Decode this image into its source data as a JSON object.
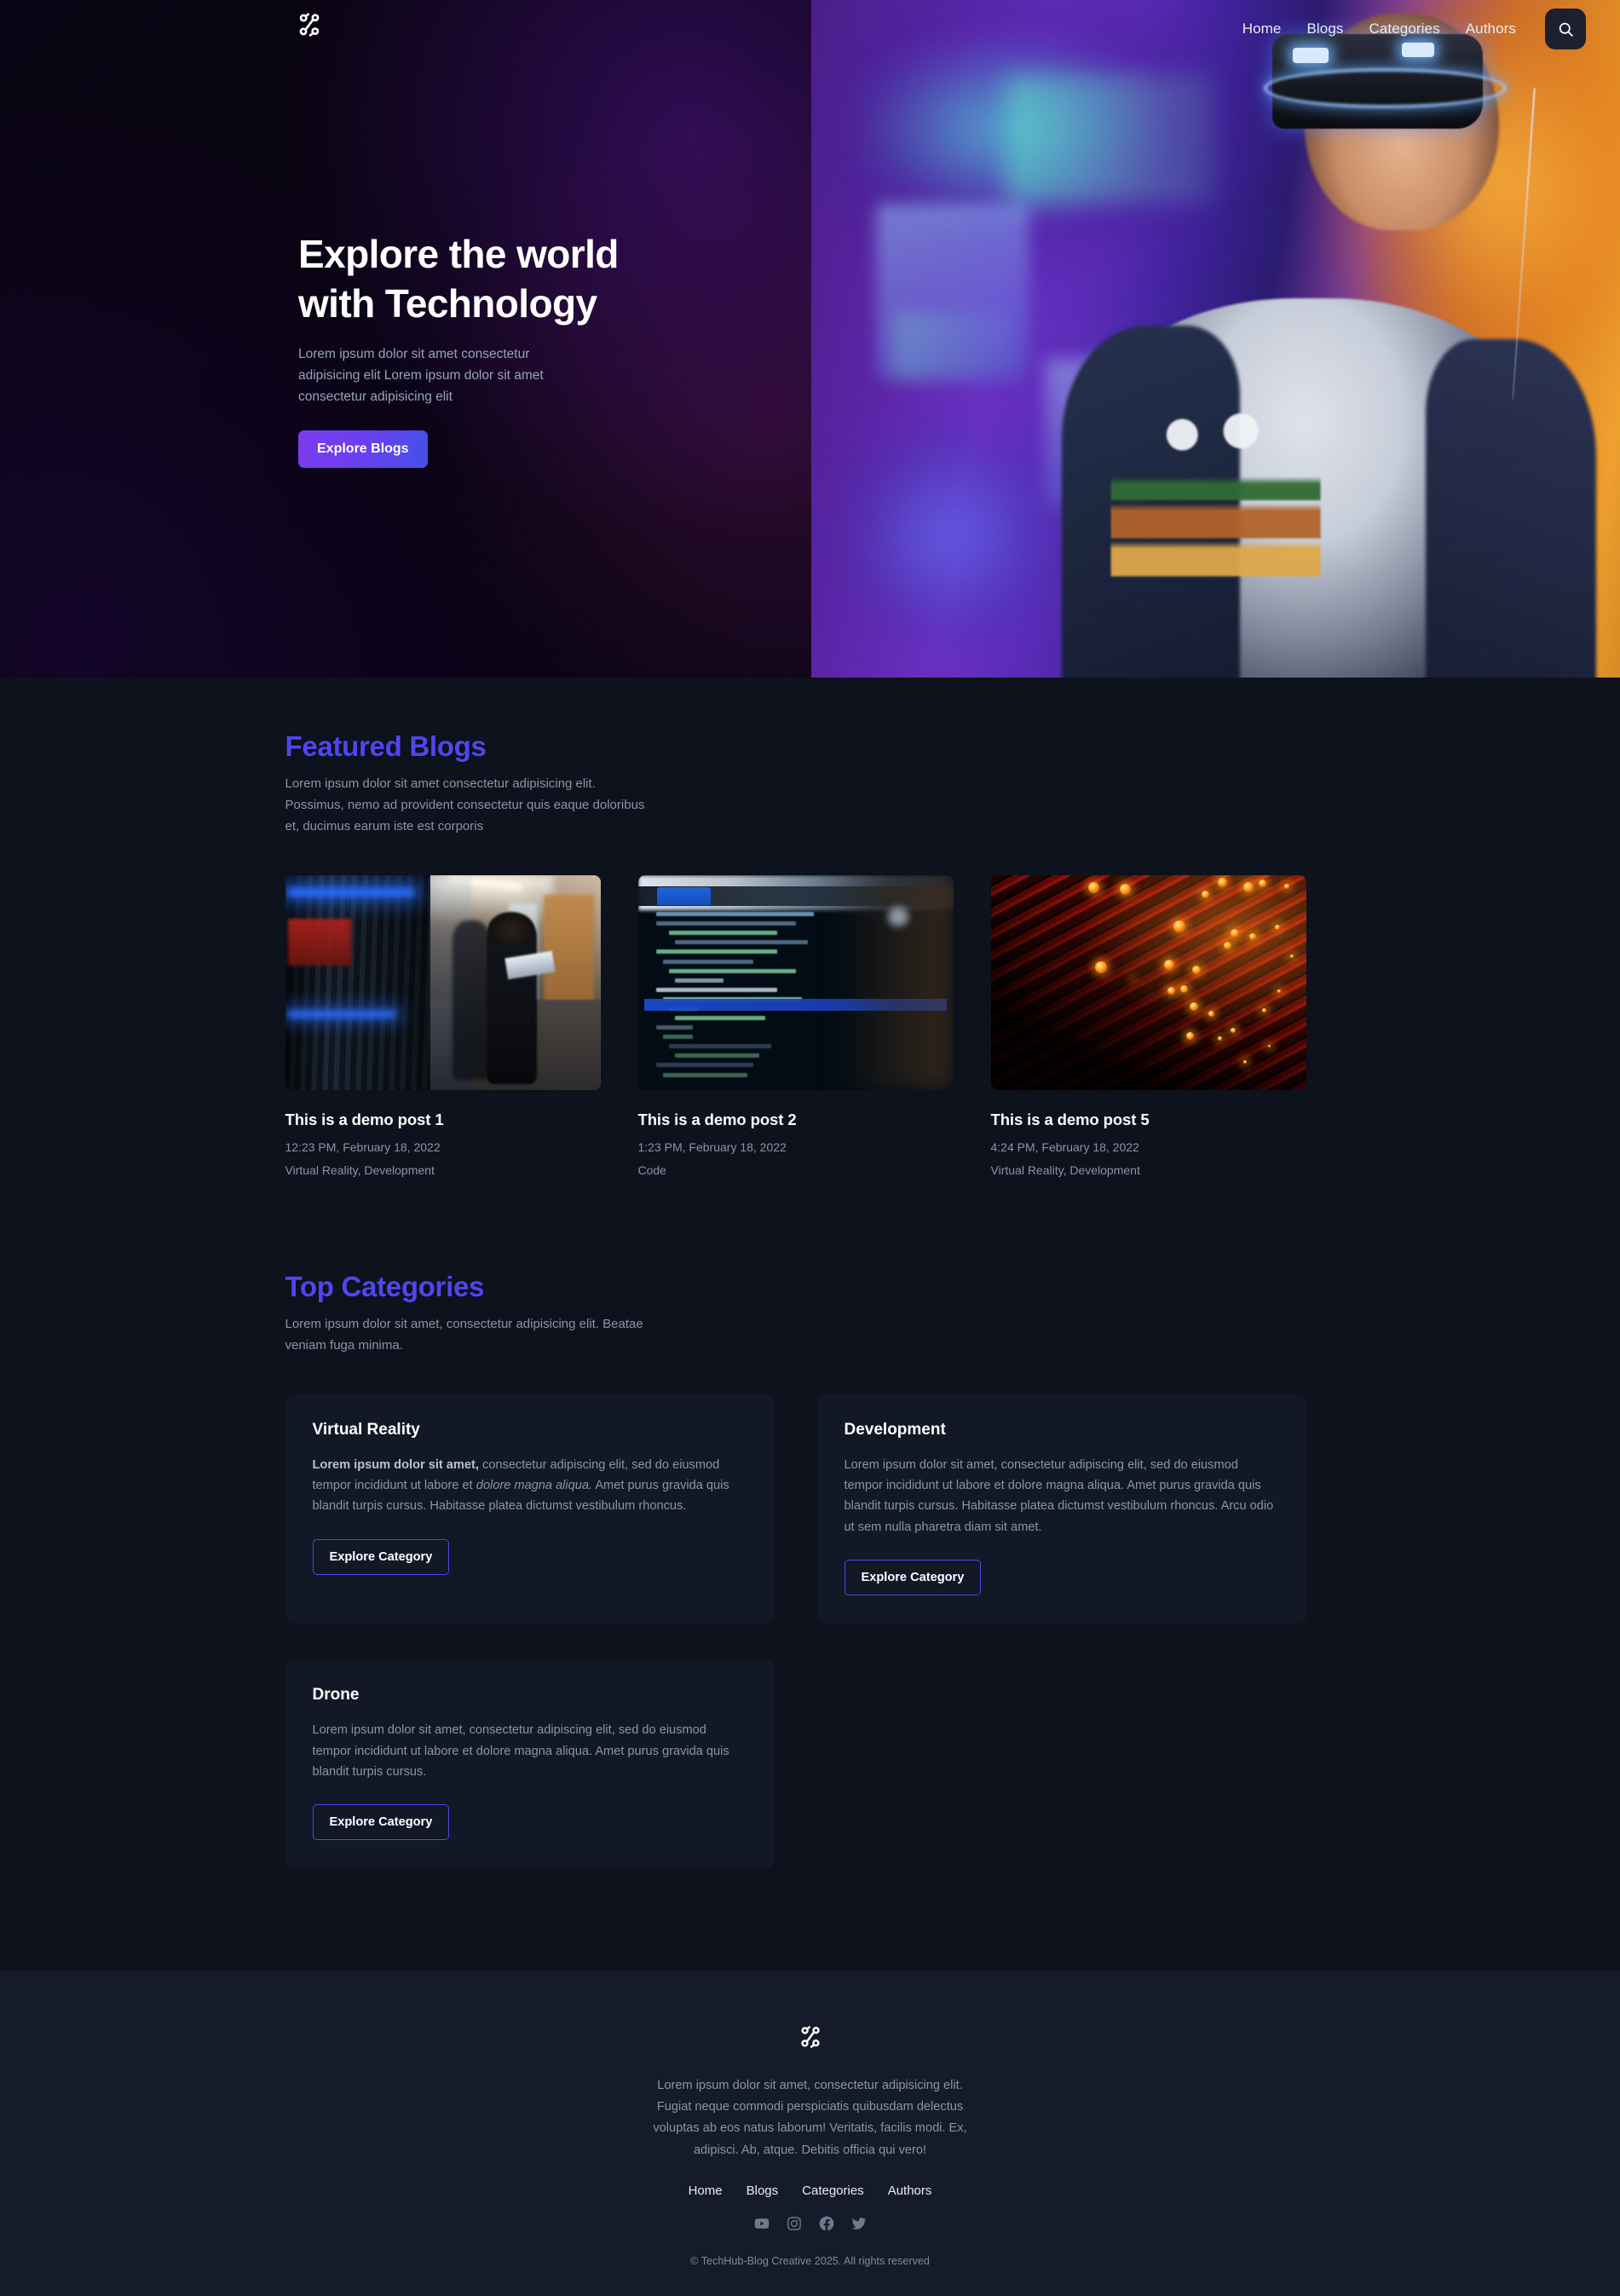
{
  "header": {
    "logo_icon": "network-nodes-logo",
    "nav": [
      {
        "label": "Home"
      },
      {
        "label": "Blogs"
      },
      {
        "label": "Categories"
      },
      {
        "label": "Authors"
      }
    ],
    "search_icon": "search-icon"
  },
  "hero": {
    "title_line1": "Explore the world",
    "title_line2": "with Technology",
    "subtitle": "Lorem ipsum dolor sit amet consectetur adipisicing elit Lorem ipsum dolor sit amet consectetur adipisicing elit",
    "cta_label": "Explore Blogs",
    "image_alt": "boy-wearing-vr-headset-in-arcade"
  },
  "featured": {
    "title": "Featured Blogs",
    "subtitle": "Lorem ipsum dolor sit amet consectetur adipisicing elit. Possimus, nemo ad provident consectetur quis eaque doloribus et, ducimus earum iste est corporis",
    "posts": [
      {
        "title": "This is a demo post 1",
        "date": "12:23 PM, February 18, 2022",
        "categories": "Virtual Reality, Development",
        "image_alt": "woman-with-laptop-in-server-room"
      },
      {
        "title": "This is a demo post 2",
        "date": "1:23 PM, February 18, 2022",
        "categories": "Code",
        "image_alt": "browser-devtools-inspector-html-code"
      },
      {
        "title": "This is a demo post 5",
        "date": "4:24 PM, February 18, 2022",
        "categories": "Virtual Reality, Development",
        "image_alt": "red-orange-fiber-optic-strands"
      }
    ]
  },
  "categories": {
    "title": "Top Categories",
    "subtitle": "Lorem ipsum dolor sit amet, consectetur adipisicing elit. Beatae veniam fuga minima.",
    "items": [
      {
        "name": "Virtual Reality",
        "body_bold": "Lorem ipsum dolor sit amet,",
        "body_part1": " consectetur adipiscing elit, sed do eiusmod tempor incididunt ut labore et ",
        "body_italic": "dolore magna aliqua.",
        "body_part2": " Amet purus gravida quis blandit turpis cursus. Habitasse platea dictumst vestibulum rhoncus.",
        "cta_label": "Explore Category"
      },
      {
        "name": "Development",
        "body": "Lorem ipsum dolor sit amet, consectetur adipiscing elit, sed do eiusmod tempor incididunt ut labore et dolore magna aliqua. Amet purus gravida quis blandit turpis cursus. Habitasse platea dictumst vestibulum rhoncus. Arcu odio ut sem nulla pharetra diam sit amet.",
        "cta_label": "Explore Category"
      },
      {
        "name": "Drone",
        "body": "Lorem ipsum dolor sit amet, consectetur adipiscing elit, sed do eiusmod tempor incididunt ut labore et dolore magna aliqua. Amet purus gravida quis blandit turpis cursus.",
        "cta_label": "Explore Category"
      }
    ]
  },
  "footer": {
    "logo_icon": "network-nodes-logo",
    "text": "Lorem ipsum dolor sit amet, consectetur adipisicing elit. Fugiat neque commodi perspiciatis quibusdam delectus voluptas ab eos natus laborum! Veritatis, facilis modi. Ex, adipisci. Ab, atque. Debitis officia qui vero!",
    "nav": [
      {
        "label": "Home"
      },
      {
        "label": "Blogs"
      },
      {
        "label": "Categories"
      },
      {
        "label": "Authors"
      }
    ],
    "socials": [
      {
        "name": "youtube-icon"
      },
      {
        "name": "instagram-icon"
      },
      {
        "name": "facebook-icon"
      },
      {
        "name": "twitter-icon"
      }
    ],
    "copyright": "© TechHub-Blog Creative 2025. All rights reserved"
  },
  "theme": {
    "accent": "#4f46f0",
    "cta_gradient_from": "#7b3ced",
    "cta_gradient_to": "#4550e8",
    "page_bg": "#0d121c",
    "hero_bg": "#07030f",
    "card_bg": "#121826",
    "footer_bg": "#151b28",
    "muted_text": "#8b94a9"
  },
  "devtools_image_text": {
    "tabs": [
      "Inspector",
      "Console",
      "Debugger"
    ],
    "lines": [
      "href=\"http://www.google.com/chrome\"",
      "<!--HEADER BOXED FONT WHITE TRANSPARENT-->",
      "<div class=\"header-black-bg\"></div>",
      "<!--NEED FOR TRANSPARENT HEADER ON MOBILE-->",
      "<header id=\"nav\" class=\"header header-l\">",
      "<!--FEATURES 7 HALF IMG-->",
      "<div class=\"page-section bg-gray-light\">",
      "::before",
      "<div class=\"fes7-img-cont col-md-5\">",
      "<div class=\"fes7-img\" style=\"background-image\">",
      "</div>",
      "<div class=\"container\"></div>",
      "::after",
      "</div>",
      "<!--FEATURES SECTION 2-->",
      "<div class=\"page-section\"></div>",
      "<!--FEATURES SECTION 1-->",
      "<div class=\"page-section\"></div>"
    ]
  }
}
